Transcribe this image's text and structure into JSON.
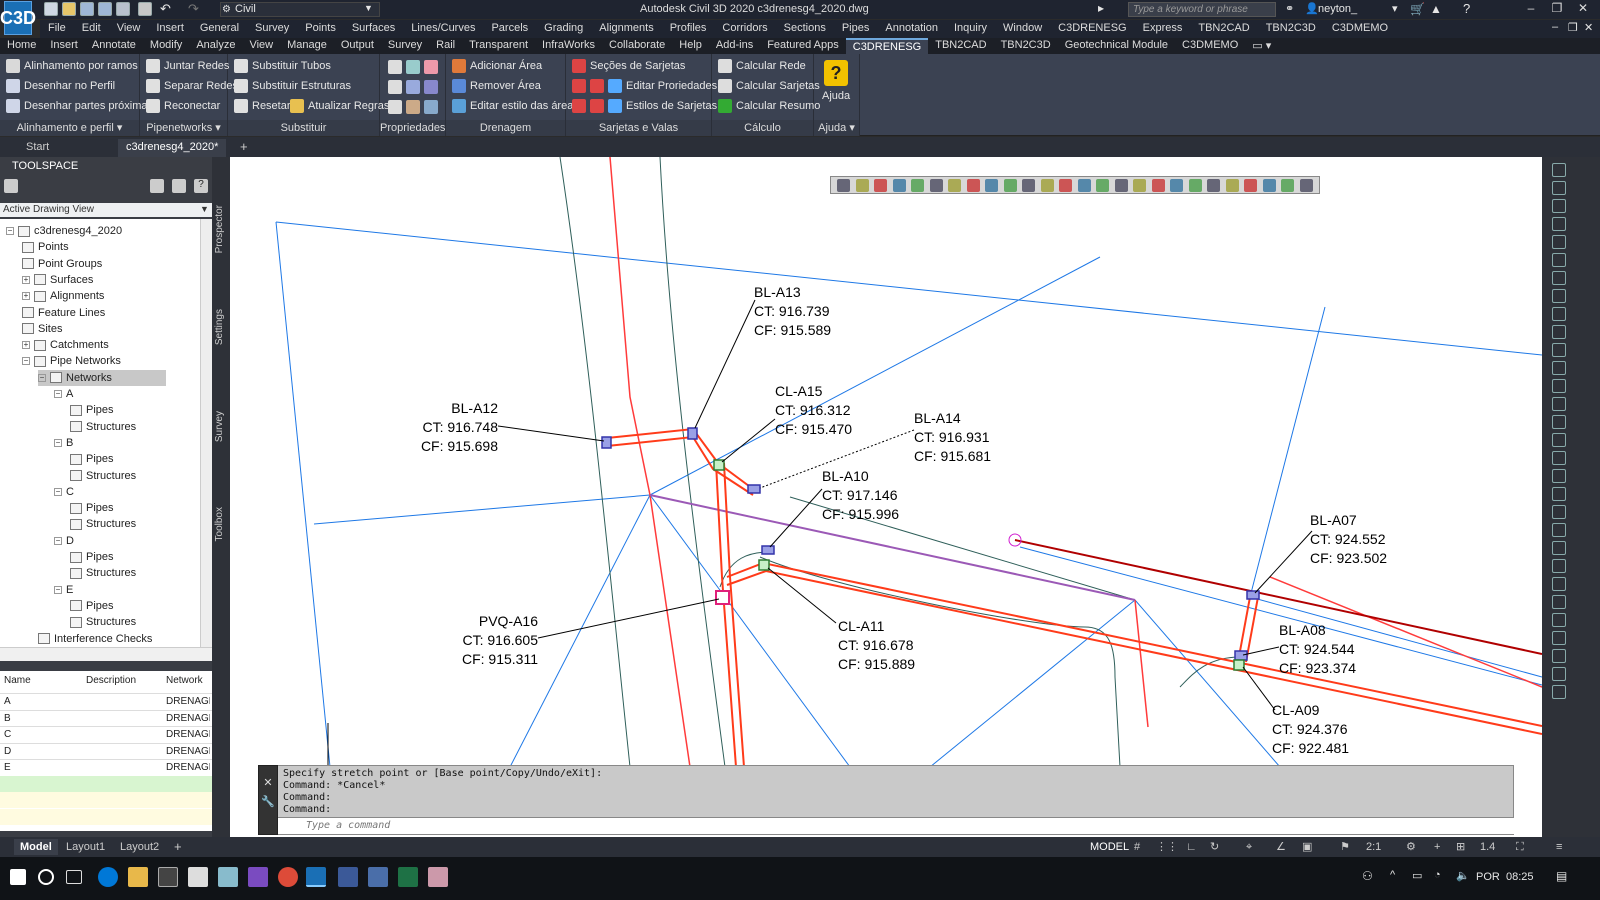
{
  "app": {
    "workspace": "Civil",
    "window_title": "Autodesk Civil 3D 2020    c3drenesg4_2020.dwg",
    "search_placeholder": "Type a keyword or phrase",
    "user": "neyton_",
    "app_icon": "C3D"
  },
  "menubar": [
    "File",
    "Edit",
    "View",
    "Insert",
    "General",
    "Survey",
    "Points",
    "Surfaces",
    "Lines/Curves",
    "Parcels",
    "Grading",
    "Alignments",
    "Profiles",
    "Corridors",
    "Sections",
    "Pipes",
    "Annotation",
    "Inquiry",
    "Window",
    "C3DRENESG",
    "Express",
    "TBN2CAD",
    "TBN2C3D",
    "C3DMEMO"
  ],
  "ribbon_tabs": [
    "Home",
    "Insert",
    "Annotate",
    "Modify",
    "Analyze",
    "View",
    "Manage",
    "Output",
    "Survey",
    "Rail",
    "Transparent",
    "InfraWorks",
    "Collaborate",
    "Help",
    "Add-ins",
    "Featured Apps",
    "C3DRENESG",
    "TBN2CAD",
    "TBN2C3D",
    "Geotechnical Module",
    "C3DMEMO"
  ],
  "ribbon_active_tab": "C3DRENESG",
  "ribbon": {
    "p1": {
      "title": "Alinhamento e perfil",
      "items": [
        "Alinhamento por ramos",
        "Desenhar no Perfil",
        "Desenhar partes próximas"
      ]
    },
    "p2": {
      "title": "Pipenetworks",
      "items": [
        "Juntar Redes",
        "Separar Redes",
        "Reconectar"
      ]
    },
    "p3": {
      "title": "Substituir",
      "items": [
        "Substituir Tubos",
        "Substituir Estruturas",
        "Resetar",
        "Atualizar Regras"
      ]
    },
    "p4": {
      "title": "Propriedades"
    },
    "p5": {
      "title": "Drenagem",
      "items": [
        "Adicionar Área",
        "Remover Área",
        "Editar estilo das áreas"
      ]
    },
    "p6": {
      "title": "Sarjetas e Valas",
      "items": [
        "Seções de Sarjetas",
        "Editar Proriedades",
        "Estilos de Sarjetas"
      ]
    },
    "p7": {
      "title": "Cálculo",
      "items": [
        "Calcular Rede",
        "Calcular Sarjetas",
        "Calcular Resumo"
      ]
    },
    "p8": {
      "title": "Ajuda",
      "items": [
        "Ajuda"
      ]
    }
  },
  "doc_tabs": [
    "Start",
    "c3drenesg4_2020*"
  ],
  "toolspace": {
    "title": "TOOLSPACE",
    "view": "Active Drawing View",
    "side_tabs": [
      "Prospector",
      "Settings",
      "Survey",
      "Toolbox"
    ],
    "tree": [
      {
        "label": "c3drenesg4_2020",
        "level": 0
      },
      {
        "label": "Points",
        "level": 1
      },
      {
        "label": "Point Groups",
        "level": 1
      },
      {
        "label": "Surfaces",
        "level": 1
      },
      {
        "label": "Alignments",
        "level": 1
      },
      {
        "label": "Feature Lines",
        "level": 1
      },
      {
        "label": "Sites",
        "level": 1
      },
      {
        "label": "Catchments",
        "level": 1
      },
      {
        "label": "Pipe Networks",
        "level": 1
      },
      {
        "label": "Networks",
        "level": 2
      },
      {
        "label": "A",
        "level": 3
      },
      {
        "label": "Pipes",
        "level": 4
      },
      {
        "label": "Structures",
        "level": 4
      },
      {
        "label": "B",
        "level": 3
      },
      {
        "label": "Pipes",
        "level": 4
      },
      {
        "label": "Structures",
        "level": 4
      },
      {
        "label": "C",
        "level": 3
      },
      {
        "label": "Pipes",
        "level": 4
      },
      {
        "label": "Structures",
        "level": 4
      },
      {
        "label": "D",
        "level": 3
      },
      {
        "label": "Pipes",
        "level": 4
      },
      {
        "label": "Structures",
        "level": 4
      },
      {
        "label": "E",
        "level": 3
      },
      {
        "label": "Pipes",
        "level": 4
      },
      {
        "label": "Structures",
        "level": 4
      },
      {
        "label": "Interference Checks",
        "level": 2
      }
    ],
    "grid_headers": [
      "Name",
      "Description",
      "Network"
    ],
    "grid_rows": [
      [
        "A",
        "",
        "DRENAGEI"
      ],
      [
        "B",
        "",
        "DRENAGEI"
      ],
      [
        "C",
        "",
        "DRENAGEI"
      ],
      [
        "D",
        "",
        "DRENAGEI"
      ],
      [
        "E",
        "",
        "DRENAGEI"
      ]
    ]
  },
  "labels": [
    {
      "name": "BL-A13",
      "ct": "CT: 916.739",
      "cf": "CF: 915.589"
    },
    {
      "name": "CL-A15",
      "ct": "CT: 916.312",
      "cf": "CF: 915.470"
    },
    {
      "name": "BL-A12",
      "ct": "CT: 916.748",
      "cf": "CF: 915.698"
    },
    {
      "name": "BL-A14",
      "ct": "CT: 916.931",
      "cf": "CF: 915.681"
    },
    {
      "name": "BL-A10",
      "ct": "CT: 917.146",
      "cf": "CF: 915.996"
    },
    {
      "name": "BL-A07",
      "ct": "CT: 924.552",
      "cf": "CF: 923.502"
    },
    {
      "name": "PVQ-A16",
      "ct": "CT: 916.605",
      "cf": "CF: 915.311"
    },
    {
      "name": "CL-A11",
      "ct": "CT: 916.678",
      "cf": "CF: 915.889"
    },
    {
      "name": "BL-A08",
      "ct": "CT: 924.544",
      "cf": "CF: 923.374"
    },
    {
      "name": "CL-A09",
      "ct": "CT: 924.376",
      "cf": "CF: 922.481"
    }
  ],
  "command": {
    "history": [
      "Specify stretch point or [Base point/Copy/Undo/eXit]:",
      "Command: *Cancel*",
      "Command:",
      "Command:"
    ],
    "placeholder": "Type a command"
  },
  "layout_tabs": [
    "Model",
    "Layout1",
    "Layout2"
  ],
  "status": {
    "model": "MODEL",
    "scale": "2:1",
    "ann": "1.4"
  },
  "tray": {
    "lang": "POR",
    "time": "08:25"
  },
  "colors": {
    "pipe_red": "#ff3b1a",
    "pipe_dark": "#b00000",
    "blue": "#1e78e6",
    "purple": "#9b59b6",
    "structure": "#3333aa",
    "manhole": "#2e7d32"
  }
}
